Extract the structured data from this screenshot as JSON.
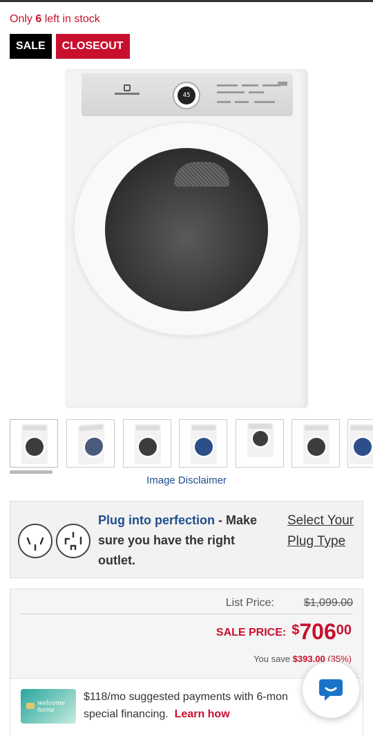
{
  "stock": {
    "prefix": "Only ",
    "count": "6",
    "suffix": " left in stock"
  },
  "badges": {
    "sale": "SALE",
    "closeout": "CLOSEOUT"
  },
  "product_image": {
    "display_reading": "45"
  },
  "thumbnails": {
    "count": 7,
    "selected_index": 0
  },
  "image_disclaimer": "Image Disclaimer",
  "plug": {
    "highlight": "Plug into perfection",
    "message": " - Make sure you have the right outlet.",
    "link": "Select Your Plug Type"
  },
  "price": {
    "list_label": "List Price:",
    "list_value": "$1,099.00",
    "sale_label": "SALE PRICE:",
    "currency": "$",
    "dollars": "706",
    "cents": "00",
    "save_prefix": "You save ",
    "save_amount": "$393.00",
    "save_percent": " (35%)"
  },
  "finance": {
    "text_line1": "$118/mo suggested payments with 6-mon",
    "text_line2": "special financing.",
    "link": "Learn how",
    "card_text": "welcome home"
  },
  "chat": {
    "icon": "chat-bubble-icon"
  },
  "colors": {
    "accent_red": "#c8102e",
    "link_blue": "#1f4e8c"
  }
}
